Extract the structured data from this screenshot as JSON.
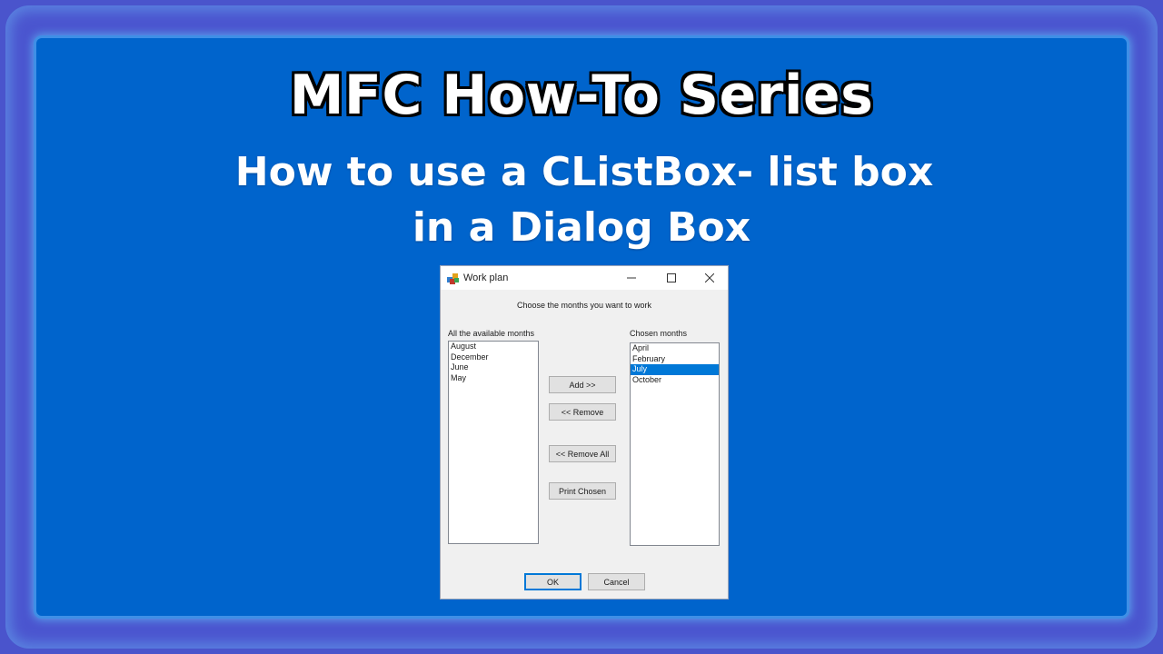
{
  "slide": {
    "title": "MFC How-To Series",
    "subtitle_line1": "How to use a CListBox- list box",
    "subtitle_line2": "in a Dialog Box"
  },
  "dialog": {
    "title": "Work plan",
    "prompt": "Choose the months you want to work",
    "available": {
      "label": "All the available months",
      "items": [
        "August",
        "December",
        "June",
        "May"
      ]
    },
    "chosen": {
      "label": "Chosen months",
      "items": [
        "April",
        "February",
        "July",
        "October"
      ],
      "selected_index": 2
    },
    "buttons": {
      "add": "Add >>",
      "remove": "<< Remove",
      "remove_all": "<< Remove All",
      "print_chosen": "Print Chosen",
      "ok": "OK",
      "cancel": "Cancel"
    }
  },
  "colors": {
    "panel": "#0064cc",
    "frame": "#4a54cc",
    "selection": "#0078d7"
  },
  "icons": {
    "app": "app-icon",
    "minimize": "minimize-icon",
    "maximize": "maximize-icon",
    "close": "close-icon"
  }
}
